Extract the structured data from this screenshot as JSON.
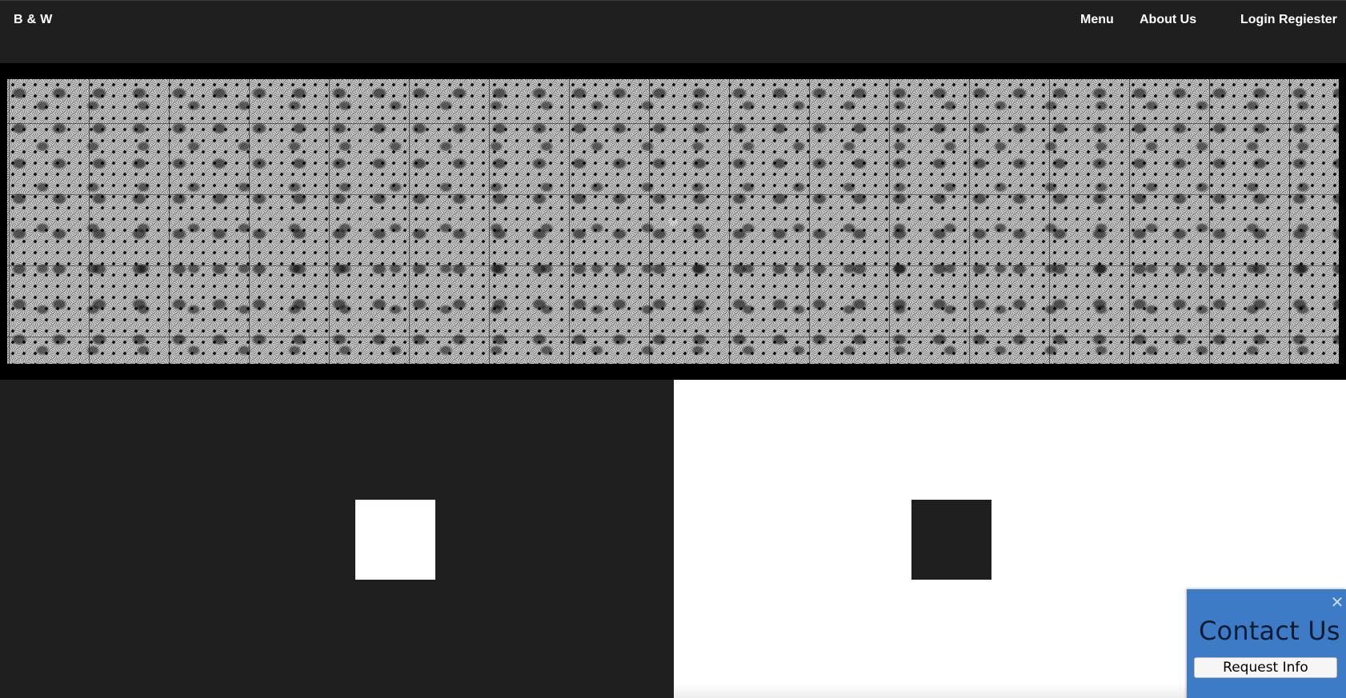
{
  "header": {
    "brand": "B & W",
    "nav": {
      "menu": "Menu",
      "about": "About Us",
      "login": "Login Regiester"
    }
  },
  "hero": {
    "image": "black-and-white-daisy-flowers-pattern"
  },
  "panels": {
    "left_background": "#1f1f1f",
    "left_square_color": "#ffffff",
    "right_background": "#ffffff",
    "right_square_color": "#1f1f1f"
  },
  "contact_widget": {
    "title": "Contact Us",
    "button": "Request Info",
    "close_icon": "close-icon",
    "background": "#3e7bc6"
  }
}
